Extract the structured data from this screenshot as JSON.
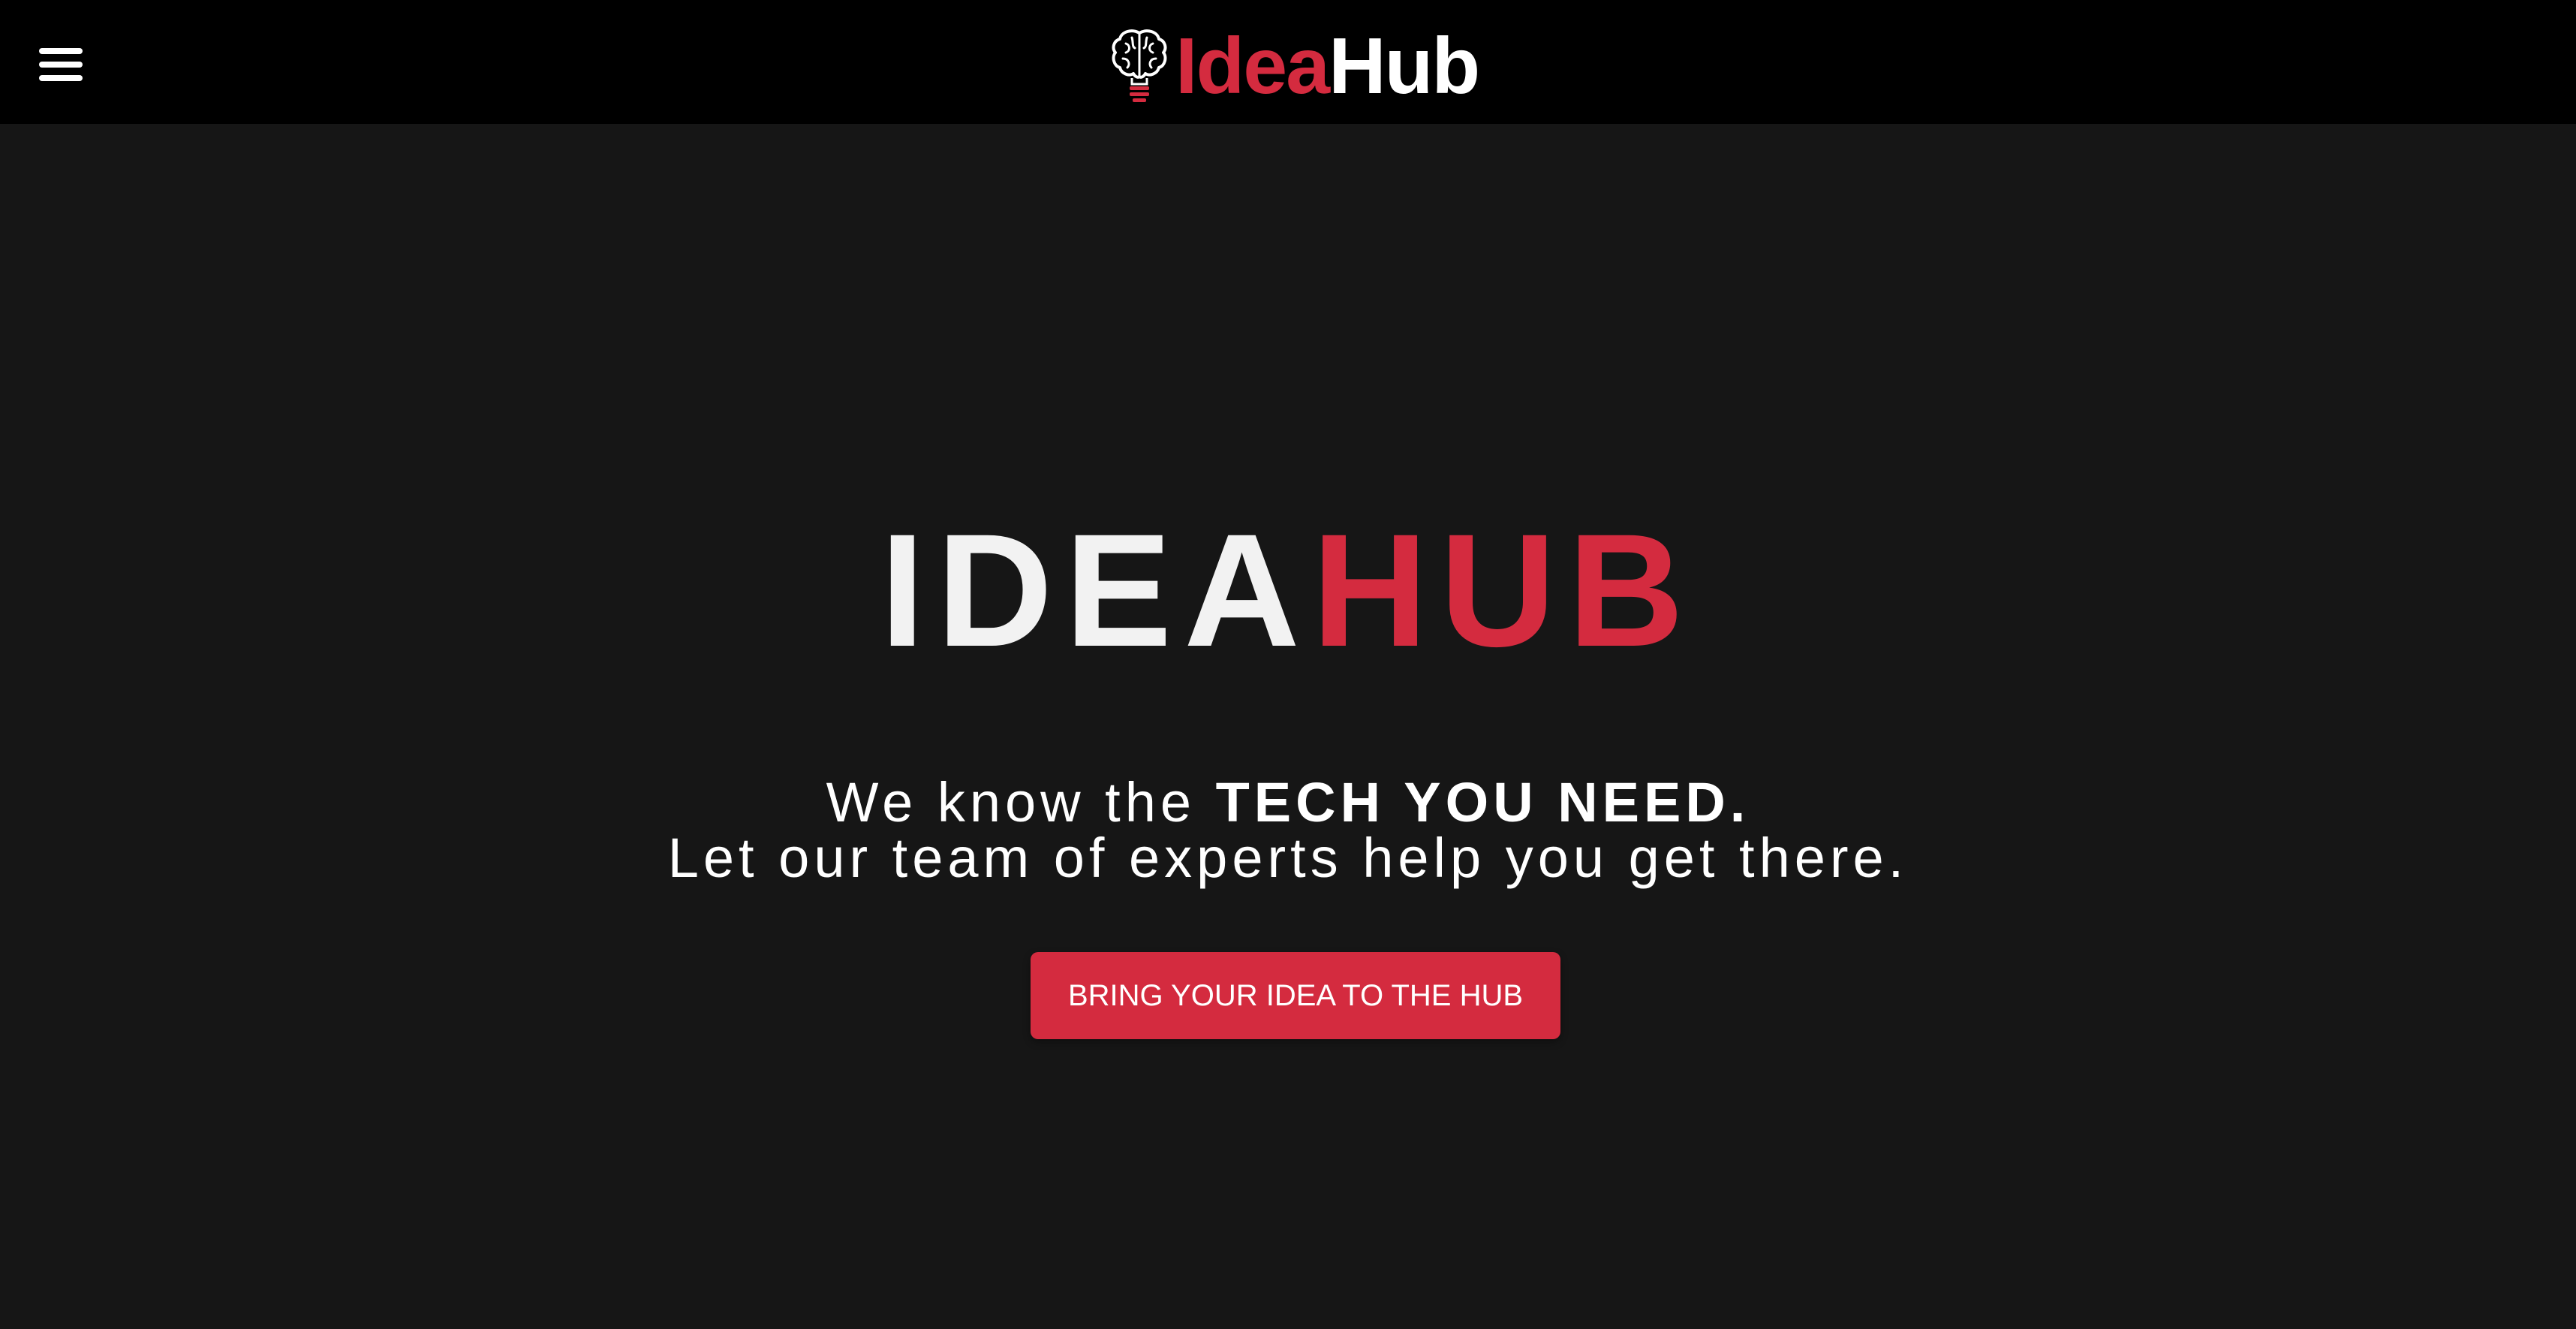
{
  "header": {
    "menu_icon": "hamburger-menu-icon",
    "logo_icon": "brain-lightbulb-icon",
    "brand_part1": "Idea",
    "brand_part2": "Hub"
  },
  "hero": {
    "title_part1": "IDEA",
    "title_part2": "HUB",
    "tagline_line1_prefix": "We know the ",
    "tagline_line1_strong": "TECH YOU NEED.",
    "tagline_line2": "Let our team of experts help you get there.",
    "cta_label": "BRING YOUR IDEA TO THE HUB"
  },
  "colors": {
    "header_bg": "#000000",
    "page_bg": "#161616",
    "accent_red": "#d42b3f",
    "text_white": "#ffffff"
  }
}
